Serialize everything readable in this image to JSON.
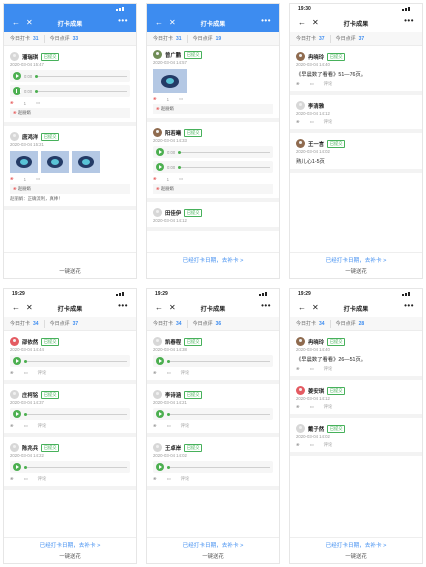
{
  "panels": [
    {
      "time": "",
      "title": "打卡成果",
      "stats": {
        "a_label": "今日打卡",
        "a_value": "31",
        "b_label": "今日点评",
        "b_value": "33"
      },
      "records": [
        {
          "name": "潘瑞琪",
          "badge": "已提交",
          "date": "2020-03-04 15:47",
          "text": "",
          "player_a": "0:00",
          "player_b": "0:00",
          "flowers": "1",
          "comment": "",
          "likes": "赵丽娟"
        },
        {
          "name": "唐鸿洋",
          "badge": "已提交",
          "date": "2020-03-04 15:21",
          "text": "",
          "flowers": "1",
          "comment": "",
          "likes": "赵丽娟",
          "note": "赵丽娟：正确流利，真棒！"
        }
      ],
      "footer_notice": "",
      "footer_button": "一键送花"
    },
    {
      "time": "",
      "title": "打卡成果",
      "stats": {
        "a_label": "今日打卡",
        "a_value": "31",
        "b_label": "今日点评",
        "b_value": "19"
      },
      "records": [
        {
          "name": "曾广鹏",
          "badge": "已提交",
          "date": "2020-03-04 14:57",
          "flowers": "1",
          "likes": "赵丽娟"
        },
        {
          "name": "阳若曦",
          "badge": "已提交",
          "date": "2020-03-04 14:33",
          "player_a": "0:00",
          "player_b": "0:00",
          "flowers": "1",
          "likes": "赵丽娟"
        },
        {
          "name": "田佳伊",
          "badge": "已提交",
          "date": "2020-03-04 14:12"
        }
      ],
      "footer_notice": "已经打卡日期，去补卡 >",
      "footer_button": ""
    },
    {
      "time": "19:30",
      "title": "打卡成果",
      "stats": {
        "a_label": "今日打卡",
        "a_value": "37",
        "b_label": "今日点评",
        "b_value": "37"
      },
      "records": [
        {
          "name": "冉晓玲",
          "badge": "已提交",
          "date": "2020-03-04 14:40",
          "text": "《早晨数了看看》51—76页。",
          "comment": "评论"
        },
        {
          "name": "李清雅",
          "badge": "",
          "date": "2020-03-04 14:12",
          "comment": "评论"
        },
        {
          "name": "王一言",
          "badge": "已提交",
          "date": "2020-03-04 14:02",
          "text": "熟儿心1-5页"
        }
      ],
      "footer_notice": "已经打卡日期，去补卡 >",
      "footer_button": "一键送花"
    },
    {
      "time": "19:29",
      "title": "打卡成果",
      "stats": {
        "a_label": "今日打卡",
        "a_value": "34",
        "b_label": "今日点评",
        "b_value": "37"
      },
      "records": [
        {
          "name": "邵依然",
          "badge": "已提交",
          "date": "2020-03-04 14:44",
          "comment": "评论"
        },
        {
          "name": "庄柯铭",
          "badge": "已提交",
          "date": "2020-03-04 14:37",
          "comment": "评论"
        },
        {
          "name": "陈兆兵",
          "badge": "已提交",
          "date": "2020-03-04 14:22",
          "comment": "评论"
        }
      ],
      "footer_notice": "已经打卡日期，去补卡 >",
      "footer_button": "一键送花"
    },
    {
      "time": "19:29",
      "title": "打卡成果",
      "stats": {
        "a_label": "今日打卡",
        "a_value": "34",
        "b_label": "今日点评",
        "b_value": "36"
      },
      "records": [
        {
          "name": "凯春程",
          "badge": "已提交",
          "date": "2020-03-04 14:38",
          "comment": "评论"
        },
        {
          "name": "李诗涵",
          "badge": "已提交",
          "date": "2020-03-04 14:21",
          "comment": "评论"
        },
        {
          "name": "王卓岸",
          "badge": "已提交",
          "date": "2020-03-04 14:02",
          "comment": "评论"
        }
      ],
      "footer_notice": "已经打卡日期，去补卡 >",
      "footer_button": "一键送花"
    },
    {
      "time": "19:29",
      "title": "打卡成果",
      "stats": {
        "a_label": "今日打卡",
        "a_value": "34",
        "b_label": "今日点评",
        "b_value": "28"
      },
      "records": [
        {
          "name": "冉晓玲",
          "badge": "已提交",
          "date": "2020-03-04 14:40",
          "text": "《早晨数了看看》26—51页。",
          "comment": "评论"
        },
        {
          "name": "姜安琪",
          "badge": "已提交",
          "date": "2020-03-04 14:12",
          "comment": "评论"
        },
        {
          "name": "戴子然",
          "badge": "已提交",
          "date": "2020-03-04 14:02",
          "comment": "评论"
        }
      ],
      "footer_notice": "已经打卡日期，去补卡 >",
      "footer_button": "一键送花"
    }
  ]
}
